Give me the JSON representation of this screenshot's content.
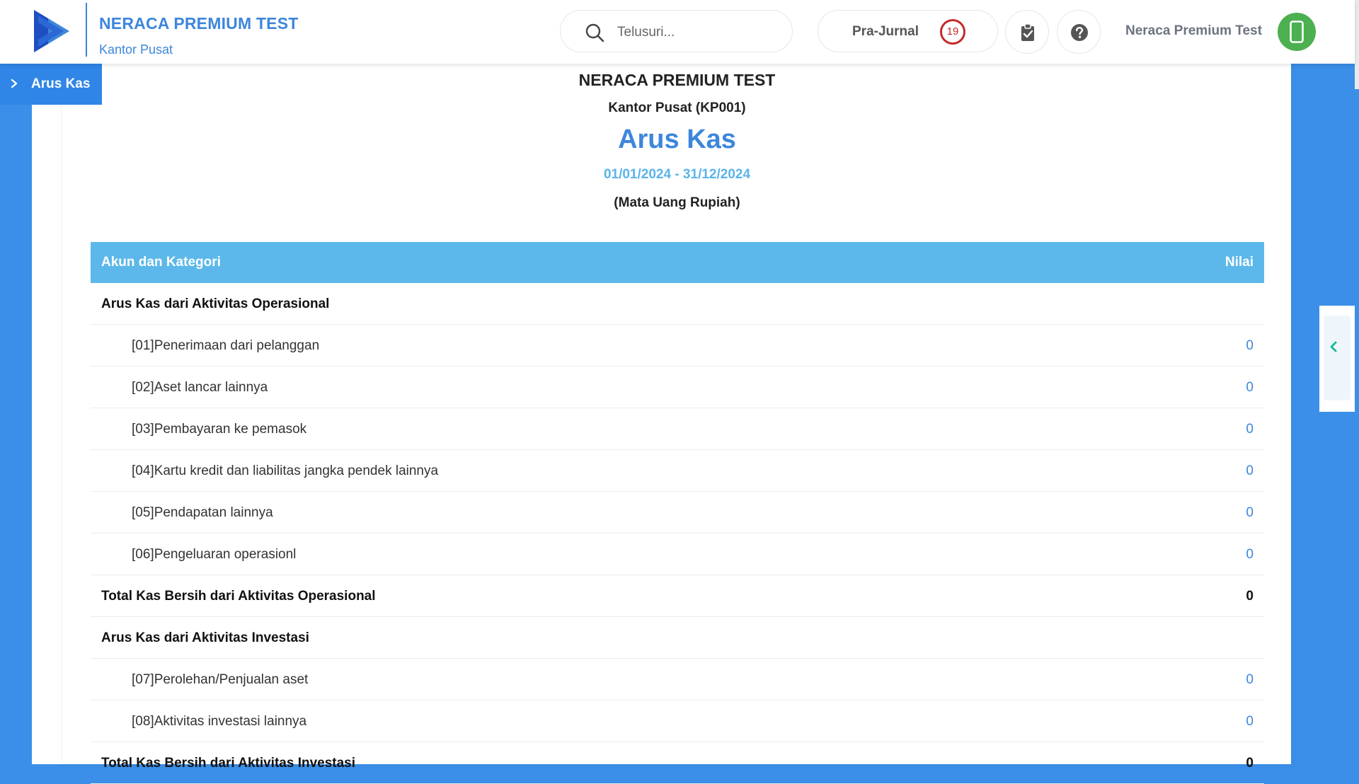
{
  "header": {
    "company_name": "NERACA PREMIUM TEST",
    "branch_name": "Kantor Pusat",
    "search_placeholder": "Telusuri...",
    "prajurnal_label": "Pra-Jurnal",
    "prajurnal_count": "19",
    "user_name": "Neraca Premium Test"
  },
  "breadcrumb": {
    "label": "Arus Kas"
  },
  "report": {
    "company": "NERACA PREMIUM TEST",
    "branch": "Kantor Pusat (KP001)",
    "title": "Arus Kas",
    "period": "01/01/2024 - 31/12/2024",
    "currency": "(Mata Uang Rupiah)"
  },
  "table": {
    "col_name": "Akun dan Kategori",
    "col_value": "Nilai",
    "rows": [
      {
        "type": "group",
        "name": "Arus Kas dari Aktivitas Operasional",
        "value": ""
      },
      {
        "type": "item",
        "name": "[01]Penerimaan dari pelanggan",
        "value": "0"
      },
      {
        "type": "item",
        "name": "[02]Aset lancar lainnya",
        "value": "0"
      },
      {
        "type": "item",
        "name": "[03]Pembayaran ke pemasok",
        "value": "0"
      },
      {
        "type": "item",
        "name": "[04]Kartu kredit dan liabilitas jangka pendek lainnya",
        "value": "0"
      },
      {
        "type": "item",
        "name": "[05]Pendapatan lainnya",
        "value": "0"
      },
      {
        "type": "item",
        "name": "[06]Pengeluaran operasionl",
        "value": "0"
      },
      {
        "type": "total",
        "name": "Total Kas Bersih dari Aktivitas Operasional",
        "value": "0"
      },
      {
        "type": "group",
        "name": "Arus Kas dari Aktivitas Investasi",
        "value": ""
      },
      {
        "type": "item",
        "name": "[07]Perolehan/Penjualan aset",
        "value": "0"
      },
      {
        "type": "item",
        "name": "[08]Aktivitas investasi lainnya",
        "value": "0"
      },
      {
        "type": "total",
        "name": "Total Kas Bersih dari Aktivitas Investasi",
        "value": "0"
      }
    ]
  },
  "icons": {
    "logo": "play-logo-icon",
    "search": "search-icon",
    "clipboard": "clipboard-check-icon",
    "help": "question-circle-icon",
    "avatar": "phone-icon",
    "breadcrumb": "chevron-right-icon",
    "side_toggle": "chevron-left-icon"
  },
  "colors": {
    "primary": "#3d86dc",
    "table_header": "#5cb8ea",
    "badge": "#c62828",
    "avatar": "#4caf50",
    "toggle_chevron": "#1abc9c"
  }
}
